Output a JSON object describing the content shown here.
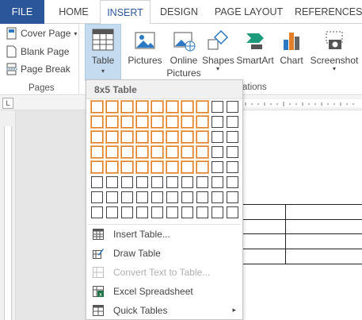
{
  "tabs": [
    {
      "label": "FILE"
    },
    {
      "label": "HOME"
    },
    {
      "label": "INSERT"
    },
    {
      "label": "DESIGN"
    },
    {
      "label": "PAGE LAYOUT"
    },
    {
      "label": "REFERENCES"
    }
  ],
  "pages_group": {
    "cover_page": "Cover Page",
    "blank_page": "Blank Page",
    "page_break": "Page Break",
    "label": "Pages"
  },
  "table_button": {
    "label": "Table",
    "arrow": "▾"
  },
  "illustrations": {
    "pictures": "Pictures",
    "online_pictures_line1": "Online",
    "online_pictures_line2": "Pictures",
    "shapes": "Shapes",
    "smartart": "SmartArt",
    "chart": "Chart",
    "screenshot": "Screenshot",
    "label_partial": "ations"
  },
  "ruler": {
    "corner": "L"
  },
  "table_menu": {
    "header": "8x5 Table",
    "grid_columns": 10,
    "grid_rows": 8,
    "selected_columns": 8,
    "selected_rows": 5,
    "highlight_color": "#e07f28",
    "items": [
      {
        "label": "Insert Table...",
        "icon": "table-icon",
        "disabled": false
      },
      {
        "label": "Draw Table",
        "icon": "pencil-icon",
        "disabled": false
      },
      {
        "label": "Convert Text to Table...",
        "icon": "convert-icon",
        "disabled": true
      },
      {
        "label": "Excel Spreadsheet",
        "icon": "excel-icon",
        "disabled": false
      },
      {
        "label": "Quick Tables",
        "icon": "quick-tables-icon",
        "disabled": false,
        "submenu_arrow": "▸"
      }
    ]
  },
  "colors": {
    "file_tab": "#2b579a",
    "active_tab_text": "#2b579a",
    "table_button_bg": "#c5dcf0"
  }
}
